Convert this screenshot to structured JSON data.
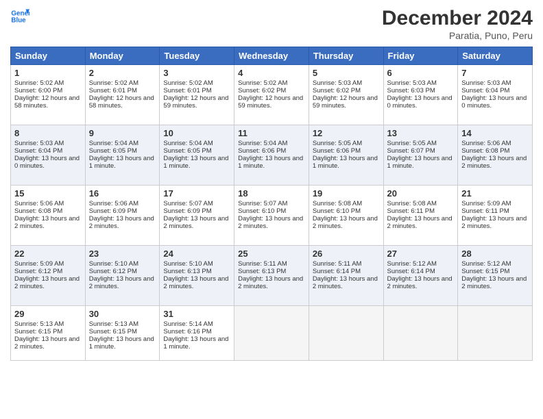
{
  "header": {
    "logo_line1": "General",
    "logo_line2": "Blue",
    "month": "December 2024",
    "location": "Paratia, Puno, Peru"
  },
  "weekdays": [
    "Sunday",
    "Monday",
    "Tuesday",
    "Wednesday",
    "Thursday",
    "Friday",
    "Saturday"
  ],
  "weeks": [
    [
      {
        "day": 1,
        "sunrise": "5:02 AM",
        "sunset": "6:00 PM",
        "daylight": "12 hours and 58 minutes."
      },
      {
        "day": 2,
        "sunrise": "5:02 AM",
        "sunset": "6:01 PM",
        "daylight": "12 hours and 58 minutes."
      },
      {
        "day": 3,
        "sunrise": "5:02 AM",
        "sunset": "6:01 PM",
        "daylight": "12 hours and 59 minutes."
      },
      {
        "day": 4,
        "sunrise": "5:02 AM",
        "sunset": "6:02 PM",
        "daylight": "12 hours and 59 minutes."
      },
      {
        "day": 5,
        "sunrise": "5:03 AM",
        "sunset": "6:02 PM",
        "daylight": "12 hours and 59 minutes."
      },
      {
        "day": 6,
        "sunrise": "5:03 AM",
        "sunset": "6:03 PM",
        "daylight": "13 hours and 0 minutes."
      },
      {
        "day": 7,
        "sunrise": "5:03 AM",
        "sunset": "6:04 PM",
        "daylight": "13 hours and 0 minutes."
      }
    ],
    [
      {
        "day": 8,
        "sunrise": "5:03 AM",
        "sunset": "6:04 PM",
        "daylight": "13 hours and 0 minutes."
      },
      {
        "day": 9,
        "sunrise": "5:04 AM",
        "sunset": "6:05 PM",
        "daylight": "13 hours and 1 minute."
      },
      {
        "day": 10,
        "sunrise": "5:04 AM",
        "sunset": "6:05 PM",
        "daylight": "13 hours and 1 minute."
      },
      {
        "day": 11,
        "sunrise": "5:04 AM",
        "sunset": "6:06 PM",
        "daylight": "13 hours and 1 minute."
      },
      {
        "day": 12,
        "sunrise": "5:05 AM",
        "sunset": "6:06 PM",
        "daylight": "13 hours and 1 minute."
      },
      {
        "day": 13,
        "sunrise": "5:05 AM",
        "sunset": "6:07 PM",
        "daylight": "13 hours and 1 minute."
      },
      {
        "day": 14,
        "sunrise": "5:06 AM",
        "sunset": "6:08 PM",
        "daylight": "13 hours and 2 minutes."
      }
    ],
    [
      {
        "day": 15,
        "sunrise": "5:06 AM",
        "sunset": "6:08 PM",
        "daylight": "13 hours and 2 minutes."
      },
      {
        "day": 16,
        "sunrise": "5:06 AM",
        "sunset": "6:09 PM",
        "daylight": "13 hours and 2 minutes."
      },
      {
        "day": 17,
        "sunrise": "5:07 AM",
        "sunset": "6:09 PM",
        "daylight": "13 hours and 2 minutes."
      },
      {
        "day": 18,
        "sunrise": "5:07 AM",
        "sunset": "6:10 PM",
        "daylight": "13 hours and 2 minutes."
      },
      {
        "day": 19,
        "sunrise": "5:08 AM",
        "sunset": "6:10 PM",
        "daylight": "13 hours and 2 minutes."
      },
      {
        "day": 20,
        "sunrise": "5:08 AM",
        "sunset": "6:11 PM",
        "daylight": "13 hours and 2 minutes."
      },
      {
        "day": 21,
        "sunrise": "5:09 AM",
        "sunset": "6:11 PM",
        "daylight": "13 hours and 2 minutes."
      }
    ],
    [
      {
        "day": 22,
        "sunrise": "5:09 AM",
        "sunset": "6:12 PM",
        "daylight": "13 hours and 2 minutes."
      },
      {
        "day": 23,
        "sunrise": "5:10 AM",
        "sunset": "6:12 PM",
        "daylight": "13 hours and 2 minutes."
      },
      {
        "day": 24,
        "sunrise": "5:10 AM",
        "sunset": "6:13 PM",
        "daylight": "13 hours and 2 minutes."
      },
      {
        "day": 25,
        "sunrise": "5:11 AM",
        "sunset": "6:13 PM",
        "daylight": "13 hours and 2 minutes."
      },
      {
        "day": 26,
        "sunrise": "5:11 AM",
        "sunset": "6:14 PM",
        "daylight": "13 hours and 2 minutes."
      },
      {
        "day": 27,
        "sunrise": "5:12 AM",
        "sunset": "6:14 PM",
        "daylight": "13 hours and 2 minutes."
      },
      {
        "day": 28,
        "sunrise": "5:12 AM",
        "sunset": "6:15 PM",
        "daylight": "13 hours and 2 minutes."
      }
    ],
    [
      {
        "day": 29,
        "sunrise": "5:13 AM",
        "sunset": "6:15 PM",
        "daylight": "13 hours and 2 minutes."
      },
      {
        "day": 30,
        "sunrise": "5:13 AM",
        "sunset": "6:15 PM",
        "daylight": "13 hours and 1 minute."
      },
      {
        "day": 31,
        "sunrise": "5:14 AM",
        "sunset": "6:16 PM",
        "daylight": "13 hours and 1 minute."
      },
      null,
      null,
      null,
      null
    ]
  ]
}
